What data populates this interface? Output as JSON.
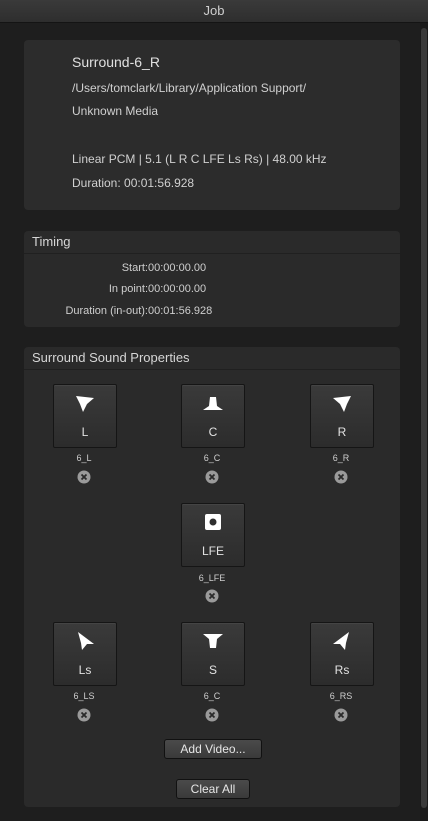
{
  "window": {
    "title": "Job"
  },
  "info": {
    "name": "Surround-6_R",
    "path": "/Users/tomclark/Library/Application Support/",
    "media": "Unknown Media",
    "format": "Linear PCM | 5.1 (L R C LFE Ls Rs) | 48.00 kHz",
    "duration": "Duration: 00:01:56.928"
  },
  "timing": {
    "title": "Timing",
    "rows": [
      {
        "label": "Start:",
        "value": "00:00:00.00"
      },
      {
        "label": "In point:",
        "value": "00:00:00.00"
      },
      {
        "label": "Duration (in-out):",
        "value": "00:01:56.928"
      }
    ]
  },
  "surround": {
    "title": "Surround Sound Properties",
    "speakers": [
      {
        "id": "L",
        "label": "L",
        "assigned": "6_L",
        "icon": "speaker-left-icon"
      },
      {
        "id": "C",
        "label": "C",
        "assigned": "6_C",
        "icon": "speaker-center-icon"
      },
      {
        "id": "R",
        "label": "R",
        "assigned": "6_R",
        "icon": "speaker-right-icon"
      },
      {
        "id": "LFE",
        "label": "LFE",
        "assigned": "6_LFE",
        "icon": "subwoofer-icon"
      },
      {
        "id": "Ls",
        "label": "Ls",
        "assigned": "6_LS",
        "icon": "speaker-left-surround-icon"
      },
      {
        "id": "S",
        "label": "S",
        "assigned": "6_C",
        "icon": "speaker-surround-icon"
      },
      {
        "id": "Rs",
        "label": "Rs",
        "assigned": "6_RS",
        "icon": "speaker-right-surround-icon"
      }
    ],
    "add_video_label": "Add Video...",
    "clear_all_label": "Clear All"
  }
}
